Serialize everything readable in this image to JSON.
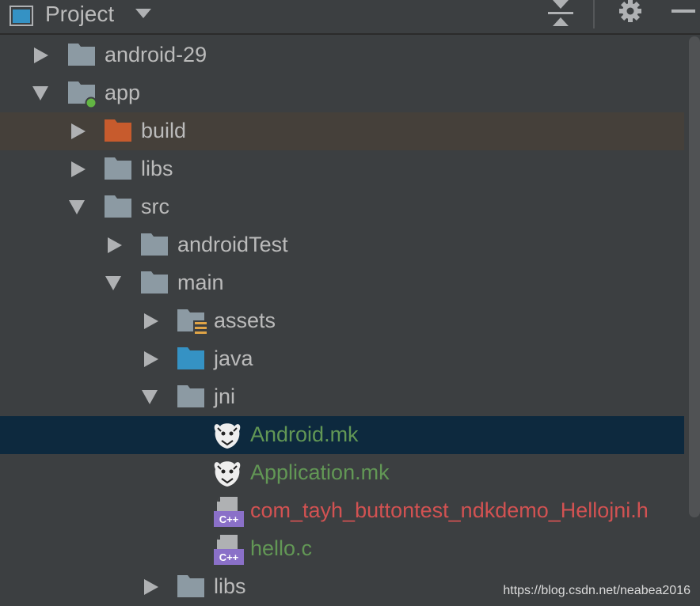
{
  "panel": {
    "title": "Project",
    "colors": {
      "background": "#3c3f41",
      "text": "#bbbbbb",
      "green_file": "#629755",
      "red_file": "#d25252",
      "selected_brown": "#45403a",
      "selected_blue": "#0d293e"
    }
  },
  "tree": {
    "android29": "android-29",
    "app": "app",
    "build": "build",
    "libs": "libs",
    "src": "src",
    "androidTest": "androidTest",
    "main": "main",
    "assets": "assets",
    "java": "java",
    "jni": "jni",
    "android_mk": "Android.mk",
    "application_mk": "Application.mk",
    "hellojni_h": "com_tayh_buttontest_ndkdemo_Hellojni.h",
    "hello_c": "hello.c",
    "libs2": "libs"
  },
  "watermark": "https://blog.csdn.net/neabea2016"
}
